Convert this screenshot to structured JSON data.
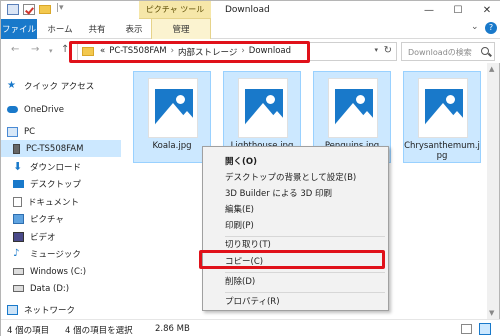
{
  "window": {
    "title": "Download",
    "tools_tab": "ピクチャ ツール",
    "quick_access_sep": "|▾",
    "minimize_label": "—",
    "maximize_label": "☐",
    "close_label": "✕"
  },
  "ribbon": {
    "tabs": [
      "ファイル",
      "ホーム",
      "共有",
      "表示",
      "管理"
    ],
    "collapse_glyph": "⌄",
    "help_glyph": "?"
  },
  "nav": {
    "back": "←",
    "forward": "→",
    "history": "▾",
    "up": "↑",
    "breadcrumb": [
      "«",
      "PC-TS508FAM",
      "›",
      "内部ストレージ",
      "›",
      "Download"
    ],
    "address_dropdown": "▾",
    "refresh": "↻",
    "search_placeholder": "Downloadの検索"
  },
  "navpane": {
    "items": [
      {
        "label": "クイック アクセス",
        "icon": "star-icon"
      },
      {
        "label": "OneDrive",
        "icon": "cloud-icon"
      },
      {
        "label": "PC",
        "icon": "pc-icon"
      },
      {
        "label": "PC-TS508FAM",
        "icon": "phone-icon"
      },
      {
        "label": "ダウンロード",
        "icon": "download-icon"
      },
      {
        "label": "デスクトップ",
        "icon": "desktop-icon"
      },
      {
        "label": "ドキュメント",
        "icon": "document-icon"
      },
      {
        "label": "ピクチャ",
        "icon": "pictures-icon"
      },
      {
        "label": "ビデオ",
        "icon": "video-icon"
      },
      {
        "label": "ミュージック",
        "icon": "music-icon"
      },
      {
        "label": "Windows (C:)",
        "icon": "drive-icon"
      },
      {
        "label": "Data (D:)",
        "icon": "drive-icon"
      },
      {
        "label": "ネットワーク",
        "icon": "network-icon"
      }
    ],
    "selected_index": 3
  },
  "files": [
    {
      "name": "Koala.jpg"
    },
    {
      "name": "Lighthouse.jpg"
    },
    {
      "name": "Penguins.jpg"
    },
    {
      "name": "Chrysanthemum.jpg"
    }
  ],
  "context_menu": {
    "items": [
      {
        "label": "開く(O)",
        "bold": true
      },
      {
        "label": "デスクトップの背景として設定(B)"
      },
      {
        "label": "3D Builder による 3D 印刷"
      },
      {
        "label": "編集(E)"
      },
      {
        "label": "印刷(P)"
      },
      {
        "label": "切り取り(T)"
      },
      {
        "label": "コピー(C)",
        "highlighted": true
      },
      {
        "label": "削除(D)"
      },
      {
        "label": "プロパティ(R)"
      }
    ]
  },
  "statusbar": {
    "count": "4 個の項目",
    "selected": "4 個の項目を選択",
    "size": "2.86 MB"
  },
  "colors": {
    "accent": "#1979ca",
    "selection": "#cce8ff",
    "highlight_red": "#e0111a",
    "tools_tab": "#f6e7a9"
  }
}
